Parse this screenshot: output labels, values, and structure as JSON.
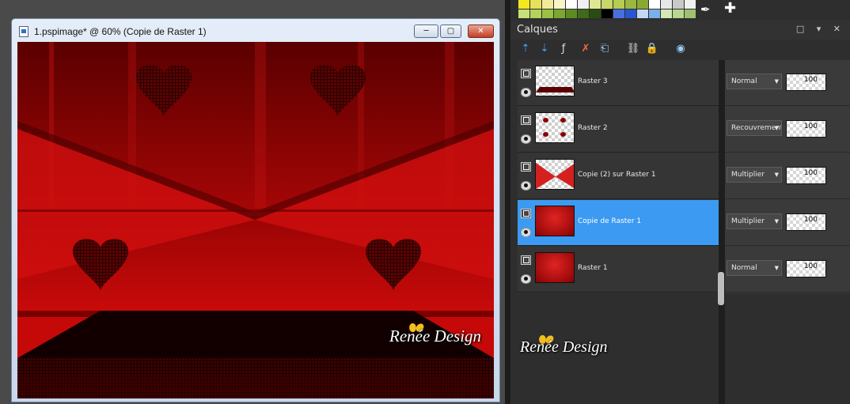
{
  "window": {
    "title": "1.pspimage* @  60% (Copie de Raster 1)",
    "btn_min": "─",
    "btn_max": "▢",
    "btn_close": "✕"
  },
  "canvas": {
    "watermark": "Renée Design"
  },
  "colors": {
    "selection": "#3c9af2",
    "canvas_red": "#cc0a0a",
    "canvas_dark": "#4a0000"
  },
  "swatches": [
    "#f5e81e",
    "#e8e05a",
    "#f2ec9a",
    "#f8f5c8",
    "#ffffff",
    "#f0f0f0",
    "#dfe890",
    "#c7d86a",
    "#b6cc52",
    "#9ab83d",
    "#8aa932",
    "#ffffff",
    "#e8e8e8",
    "#c9c9c9",
    "#f0f0f0",
    "#c6e07a",
    "#b3d25c",
    "#9bc244",
    "#7da733",
    "#5e8a22",
    "#3f6a18",
    "#2a4c10",
    "#000000",
    "#4a6ee0",
    "#2a56d0",
    "#c4d8f5",
    "#7ab0e8",
    "#d4e8b8",
    "#b8d890",
    "#a0c070"
  ],
  "tools": {
    "picker_icon": "pipette-icon",
    "picker": "✒",
    "add": "✚"
  },
  "layers_panel": {
    "title": "Calques",
    "header_controls": "□ ▾ ✕",
    "toolbar": [
      {
        "name": "new-raster-layer-icon",
        "glyph": "⇡",
        "color": "#4aa3ff"
      },
      {
        "name": "new-vector-layer-icon",
        "glyph": "⇣",
        "color": "#4aa3ff"
      },
      {
        "name": "layer-fx-icon",
        "glyph": "ƒ",
        "color": "#dddddd"
      },
      {
        "name": "delete-layer-icon",
        "glyph": "✗",
        "color": "#ff6a3c"
      },
      {
        "name": "layer-properties-icon",
        "glyph": "⎗",
        "color": "#9bd0ff"
      },
      {
        "name": "link-icon",
        "glyph": "⛓",
        "color": "#dddddd"
      },
      {
        "name": "lock-icon",
        "glyph": "🔒",
        "color": "#f2c01c"
      },
      {
        "name": "group-icon",
        "glyph": "◉",
        "color": "#9bd0ff"
      }
    ],
    "layers": [
      {
        "name": "Raster 3",
        "blend": "Normal",
        "opacity": "100",
        "selected": false,
        "thumb": "floor"
      },
      {
        "name": "Raster 2",
        "blend": "Recouvrement",
        "opacity": "100",
        "selected": false,
        "thumb": "hearts"
      },
      {
        "name": "Copie (2) sur Raster 1",
        "blend": "Multiplier",
        "opacity": "100",
        "selected": false,
        "thumb": "bowtie"
      },
      {
        "name": "Copie de Raster 1",
        "blend": "Multiplier",
        "opacity": "100",
        "selected": true,
        "thumb": "red"
      },
      {
        "name": "Raster 1",
        "blend": "Normal",
        "opacity": "100",
        "selected": false,
        "thumb": "red"
      }
    ],
    "watermark": "Renée Design"
  }
}
